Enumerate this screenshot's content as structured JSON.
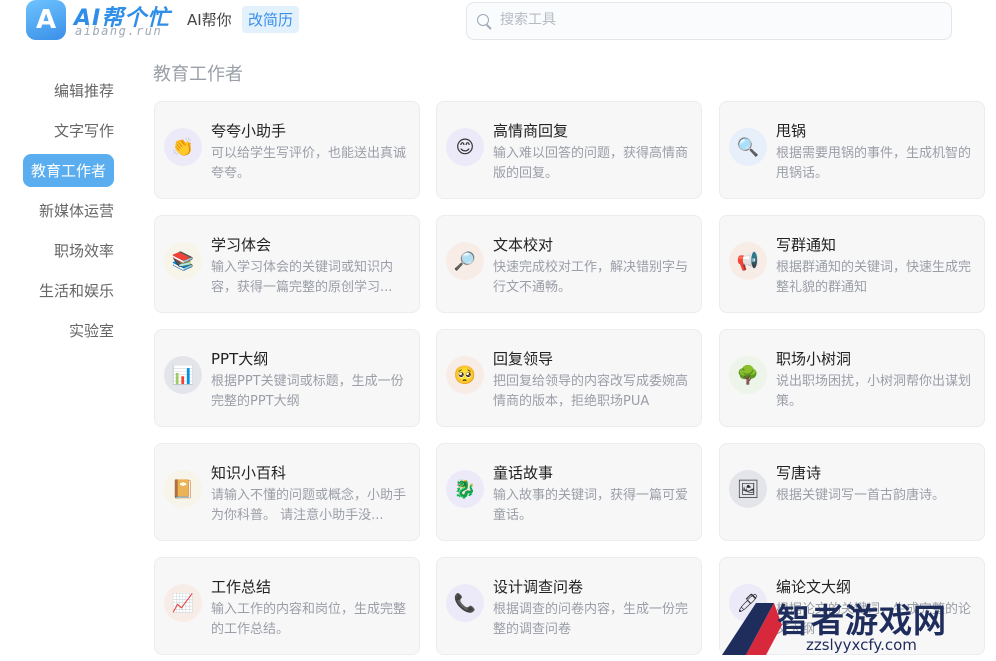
{
  "header": {
    "logo_letter": "A",
    "logo_title": "AI帮个忙",
    "logo_subtitle": "aibang.run",
    "nav_ai": "AI帮你",
    "nav_resume": "改简历",
    "search_placeholder": "搜索工具"
  },
  "sidebar": {
    "items": [
      "编辑推荐",
      "文字写作",
      "教育工作者",
      "新媒体运营",
      "职场效率",
      "生活和娱乐",
      "实验室"
    ],
    "active": "教育工作者"
  },
  "section_title": "教育工作者",
  "cards": [
    {
      "title": "夸夸小助手",
      "desc": "可以给学生写评价，也能送出真诚夸夸。",
      "icon": "clapping-hands-icon",
      "glyph": "👏",
      "bg": "#ece9f8"
    },
    {
      "title": "高情商回复",
      "desc": "输入难以回答的问题，获得高情商版的回复。",
      "icon": "smiling-face-icon",
      "glyph": "😊",
      "bg": "#ece9f8"
    },
    {
      "title": "甩锅",
      "desc": "根据需要甩锅的事件，生成机智的甩锅话。",
      "icon": "magnifier-icon",
      "glyph": "🔍",
      "bg": "#e6effa"
    },
    {
      "title": "学习体会",
      "desc": "输入学习体会的关键词或知识内容，获得一篇完整的原创学习...",
      "icon": "books-icon",
      "glyph": "📚",
      "bg": "#f7f4ea"
    },
    {
      "title": "文本校对",
      "desc": "快速完成校对工作，解决错别字与行文不通畅。",
      "icon": "search-glass-icon",
      "glyph": "🔎",
      "bg": "#f8ede6"
    },
    {
      "title": "写群通知",
      "desc": "根据群通知的关键词，快速生成完整礼貌的群通知",
      "icon": "megaphone-icon",
      "glyph": "📢",
      "bg": "#f8ede6"
    },
    {
      "title": "PPT大纲",
      "desc": "根据PPT关键词或标题，生成一份完整的PPT大纲",
      "icon": "bar-chart-icon",
      "glyph": "📊",
      "bg": "#e3e5ea"
    },
    {
      "title": "回复领导",
      "desc": "把回复给领导的内容改写成委婉高情商的版本，拒绝职场PUA",
      "icon": "pleading-face-icon",
      "glyph": "🥺",
      "bg": "#f8ede6"
    },
    {
      "title": "职场小树洞",
      "desc": "说出职场困扰，小树洞帮你出谋划策。",
      "icon": "tree-icon",
      "glyph": "🌳",
      "bg": "#edf5ea"
    },
    {
      "title": "知识小百科",
      "desc": "请输入不懂的问题或概念，小助手为你科普。 请注意小助手没...",
      "icon": "book-icon",
      "glyph": "📔",
      "bg": "#f7f4ea"
    },
    {
      "title": "童话故事",
      "desc": "输入故事的关键词，获得一篇可爱童话。",
      "icon": "seahorse-icon",
      "glyph": "🐉",
      "bg": "#ece9f8"
    },
    {
      "title": "写唐诗",
      "desc": "根据关键词写一首古韵唐诗。",
      "icon": "scroll-picture-icon",
      "glyph": "🖼",
      "bg": "#e3e5ea"
    },
    {
      "title": "工作总结",
      "desc": "输入工作的内容和岗位，生成完整的工作总结。",
      "icon": "trend-chart-icon",
      "glyph": "📈",
      "bg": "#f8ede6"
    },
    {
      "title": "设计调查问卷",
      "desc": "根据调查的问卷内容，生成一份完整的调查问卷",
      "icon": "phone-icon",
      "glyph": "📞",
      "bg": "#ece9f8"
    },
    {
      "title": "编论文大纲",
      "desc": "根据论文的关键词，生成完整的论文大纲",
      "icon": "pen-icon",
      "glyph": "🖊",
      "bg": "#ece9f8"
    }
  ],
  "watermark": {
    "text": "智者游戏网",
    "url": "zzslyyxcfy.com"
  }
}
